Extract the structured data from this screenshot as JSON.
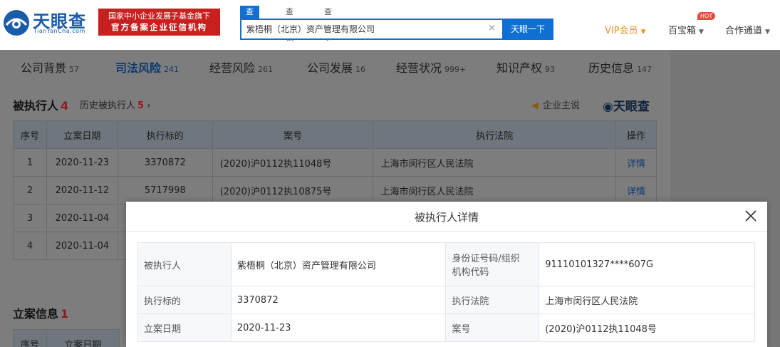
{
  "header": {
    "logo_text": "天眼查",
    "logo_sub": "TianYanCha.com",
    "badge_line1": "国家中小企业发展子基金旗下",
    "badge_line2": "官方备案企业征信机构",
    "search_tabs": [
      "查公司",
      "查老板",
      "查关系"
    ],
    "search_value": "紫梧桐（北京）资产管理有限公司",
    "search_clear": "×",
    "search_button": "天眼一下",
    "vip": "VIP会员",
    "toolbox": "百宝箱",
    "hot": "HOT",
    "partner": "合作通道"
  },
  "tabs": [
    {
      "label": "公司背景",
      "count": "57"
    },
    {
      "label": "司法风险",
      "count": "241"
    },
    {
      "label": "经营风险",
      "count": "261"
    },
    {
      "label": "公司发展",
      "count": "16"
    },
    {
      "label": "经营状况",
      "count": "999+"
    },
    {
      "label": "知识产权",
      "count": "93"
    },
    {
      "label": "历史信息",
      "count": "147"
    }
  ],
  "executed_section": {
    "title": "被执行人",
    "count": "4",
    "history_label": "历史被执行人",
    "history_count": "5",
    "company_say": "企业主说",
    "tyc_mark": "天眼查",
    "columns": [
      "序号",
      "立案日期",
      "执行标的",
      "案号",
      "执行法院",
      "操作"
    ],
    "rows": [
      {
        "no": "1",
        "date": "2020-11-23",
        "amount": "3370872",
        "case": "(2020)沪0112执11048号",
        "court": "上海市闵行区人民法院",
        "action": "详情"
      },
      {
        "no": "2",
        "date": "2020-11-12",
        "amount": "5717998",
        "case": "(2020)沪0112执10875号",
        "court": "上海市闵行区人民法院",
        "action": "详情"
      },
      {
        "no": "3",
        "date": "2020-11-04"
      },
      {
        "no": "4",
        "date": "2020-11-04"
      }
    ]
  },
  "filing_section": {
    "title": "立案信息",
    "count": "1",
    "columns": [
      "序号",
      "立案日期"
    ]
  },
  "modal": {
    "title": "被执行人详情",
    "close": "×",
    "rows": [
      {
        "k1": "被执行人",
        "v1": "紫梧桐（北京）资产管理有限公司",
        "k2a": "身份证号码/组织",
        "k2b": "机构代码",
        "v2": "91110101327****607G"
      },
      {
        "k1": "执行标的",
        "v1": "3370872",
        "k2": "执行法院",
        "v2": "上海市闵行区人民法院"
      },
      {
        "k1": "立案日期",
        "v1": "2020-11-23",
        "k2": "案号",
        "v2": "(2020)沪0112执11048号"
      }
    ]
  }
}
